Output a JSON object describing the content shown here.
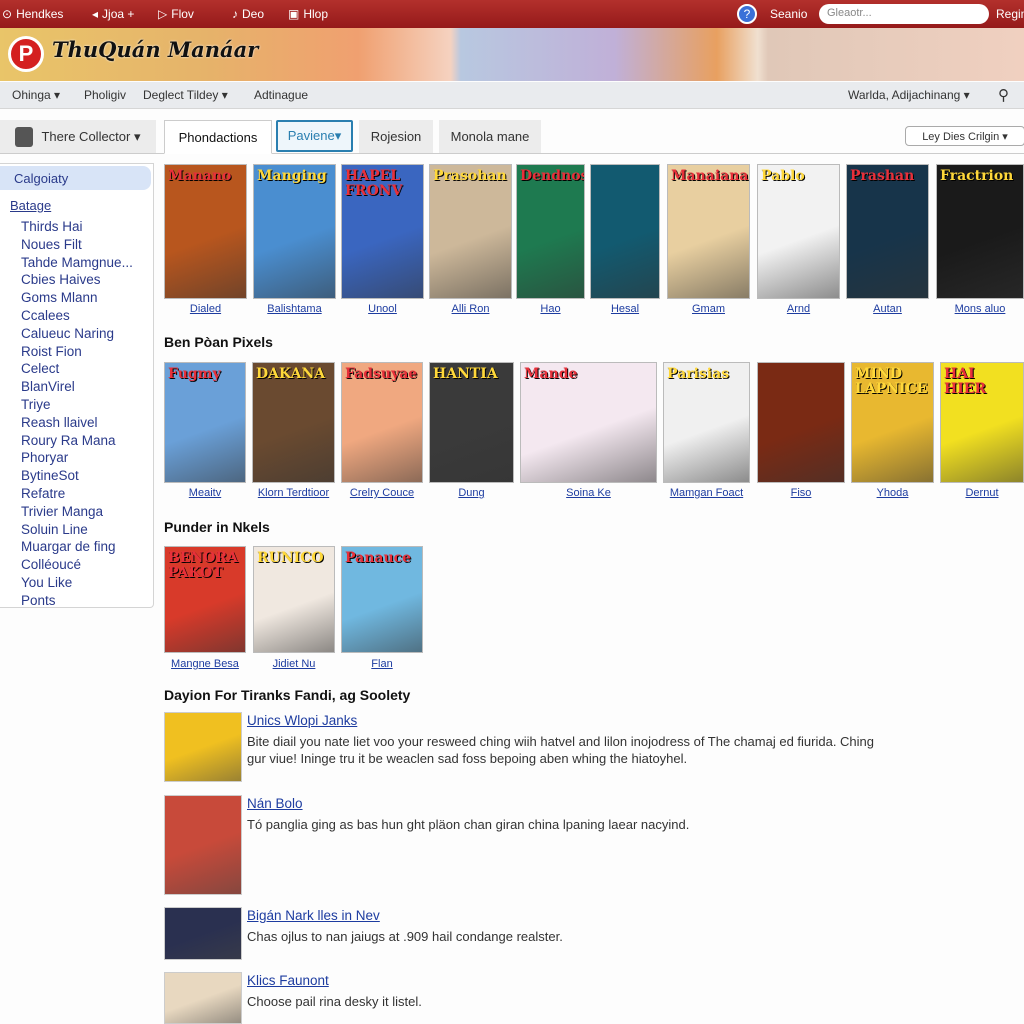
{
  "colors": {
    "topbar": "#a8201f",
    "link": "#1d3ca0",
    "accent_tab": "#2a7fb0"
  },
  "topbar": {
    "items": [
      "Hendkes",
      "Jjoa +",
      "Flov",
      "Deo",
      "Hlop"
    ],
    "icons": [
      "home-icon",
      "back-icon",
      "play-icon",
      "music-icon",
      "note-icon"
    ],
    "search_link": "Seanio",
    "search_placeholder": "Gleaotr...",
    "register": "Regim"
  },
  "site": {
    "logo_letter": "P",
    "title": "ThuQuán Manáar"
  },
  "nav": {
    "items": [
      "Ohinga ▾",
      "Pholigiv",
      "Deglect Tildey ▾",
      "Adtinague"
    ],
    "user": "Warlda, Adijachinang ▾"
  },
  "tabs": {
    "collector": "There  Collector ▾",
    "items": [
      "Phondactions",
      "Paviene▾",
      "Rojesion",
      "Monola mane"
    ],
    "sort": "Ley Dies Crilgin ▾"
  },
  "sidebar": {
    "category": "Calgoiaty",
    "group": "Batage",
    "items": [
      "Thirds Hai",
      "Noues Filt",
      "Tahde Mamgnue...",
      "Cbies Haives",
      "Goms Mlann",
      "Ccalees",
      "Calueuc Naring",
      "Roist Fion",
      "Celect",
      "BlanVirel",
      "Triye",
      "Reash llaivel",
      "Roury Ra Mana",
      "Phoryar",
      "BytineSot",
      "Refatre",
      "Trivier Manga",
      "Soluin Line",
      "Muargar de fing",
      "Colléoucé",
      "You Like",
      "Ponts"
    ]
  },
  "row1": {
    "covers": [
      {
        "title": "Manano",
        "label": "Dialed",
        "color": "#b8561e"
      },
      {
        "title": "Manging",
        "label": "Balishtama",
        "color": "#4a8ed0"
      },
      {
        "title": "HAPEL FRONV",
        "label": "Unool",
        "color": "#3a66c0"
      },
      {
        "title": "Prasohan",
        "label": "Alli Ron",
        "color": "#cdb89a"
      },
      {
        "title": "Dendnos",
        "label": "Hao",
        "color": "#1e7a50"
      },
      {
        "title": "",
        "label": "Hesal",
        "color": "#125a70"
      },
      {
        "title": "Manaiana",
        "label": "Gmam",
        "color": "#e8cfa0"
      },
      {
        "title": "Pablo",
        "label": "Arnd",
        "color": "#f2f2f2"
      },
      {
        "title": "Prashan",
        "label": "Autan",
        "color": "#17344a"
      },
      {
        "title": "Fractrion",
        "label": "Mons aluo",
        "color": "#1a1a1a"
      }
    ]
  },
  "section2": "Ben Pòan Pixels",
  "row2": {
    "covers": [
      {
        "title": "Fugmy",
        "label": "Meaitv",
        "color": "#6aa0d8"
      },
      {
        "title": "DAKANA",
        "label": "Klorn Terdtioor",
        "color": "#6a4a30"
      },
      {
        "title": "Fadsuyae",
        "label": "Crelry Couce",
        "color": "#f0a880"
      },
      {
        "title": "HANTIA",
        "label": "Dung",
        "color": "#3a3a3a"
      },
      {
        "title": "Mande",
        "label": "Soina Ke",
        "color": "#f4e8f0"
      },
      {
        "title": "Parisias",
        "label": "Mamgan Foact",
        "color": "#f0f0f0"
      },
      {
        "title": "",
        "label": "Fiso",
        "color": "#7a2a14"
      },
      {
        "title": "MIND LAPNICE",
        "label": "Yhoda",
        "color": "#e8b830"
      },
      {
        "title": "HAI HIER",
        "label": "Dernut",
        "color": "#f2e020"
      }
    ]
  },
  "section3": "Punder in Nkels",
  "row3": {
    "covers": [
      {
        "title": "BENORA PAKOT",
        "label": "Mangne Besa",
        "color": "#d83a2a"
      },
      {
        "title": "RUNICO",
        "label": "Jidiet Nu",
        "color": "#f0e8e0"
      },
      {
        "title": "Panauce",
        "label": "Flan",
        "color": "#70b8e0"
      }
    ]
  },
  "section4": "Dayion For Tiranks Fandi, ag Soolety",
  "list": [
    {
      "title": "Unics Wlopi Janks",
      "desc": "Bite diail you nate liet voo your resweed ching wiih hatvel and lilon inojodress of The chamaj ed fiurida. Ching gur viue! Ininge tru it be weaclen sad foss bepoing aben whing the hiatoyhel.",
      "color": "#f0c020"
    },
    {
      "title": "Nán Bolo",
      "desc": "Tó panglia ging as bas hun ght pläon chan giran china lpaning laear nacyind.",
      "color": "#c84a3a"
    },
    {
      "title": "Bigán Nark lles in Nev",
      "desc": "Chas ojlus to nan jaiugs at .909 hail condange realster.",
      "color": "#2a3050"
    },
    {
      "title": "Klics Faunont",
      "desc": "Choose pail rina desky it listel.",
      "color": "#e8d8c0"
    }
  ]
}
